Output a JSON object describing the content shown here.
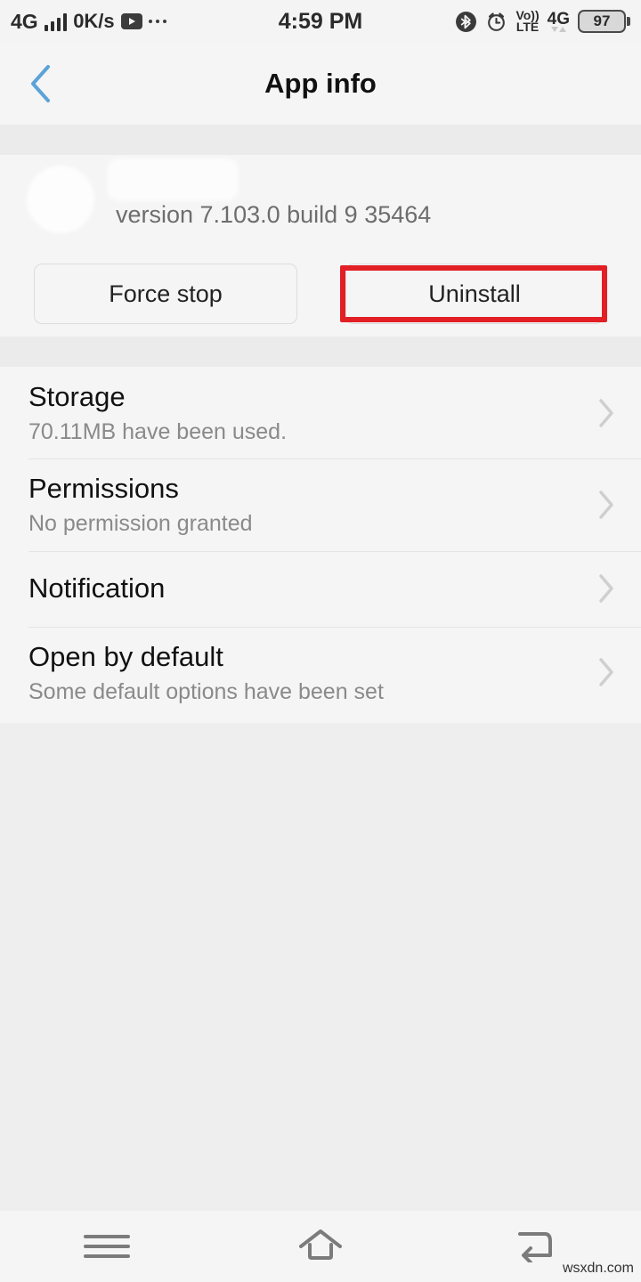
{
  "status_bar": {
    "network_label": "4G",
    "data_speed": "0K/s",
    "media_icon": "youtube-play-icon",
    "overflow_icon": "more-dots-icon",
    "time": "4:59 PM",
    "bluetooth_icon": "bluetooth-icon",
    "alarm_icon": "alarm-clock-icon",
    "volte_line1": "Vo))",
    "volte_line2": "LTE",
    "network_type": "4G",
    "battery_level": "97"
  },
  "header": {
    "back_icon": "back-chevron-icon",
    "title": "App info"
  },
  "app_summary": {
    "icon": "app-icon-redacted",
    "app_name": "",
    "version": "version 7.103.0 build 9 35464"
  },
  "actions": {
    "force_stop_label": "Force stop",
    "uninstall_label": "Uninstall",
    "highlight_color": "#e21f25"
  },
  "settings_rows": [
    {
      "title": "Storage",
      "subtitle": "70.11MB have been used.",
      "chevron": "chevron-right-icon"
    },
    {
      "title": "Permissions",
      "subtitle": "No permission granted",
      "chevron": "chevron-right-icon"
    },
    {
      "title": "Notification",
      "subtitle": "",
      "chevron": "chevron-right-icon"
    },
    {
      "title": "Open by default",
      "subtitle": "Some default options have been set",
      "chevron": "chevron-right-icon"
    }
  ],
  "nav_bar": {
    "menu_icon": "menu-icon",
    "home_icon": "home-icon",
    "back_icon": "back-arrow-icon"
  },
  "watermark": "wsxdn.com"
}
